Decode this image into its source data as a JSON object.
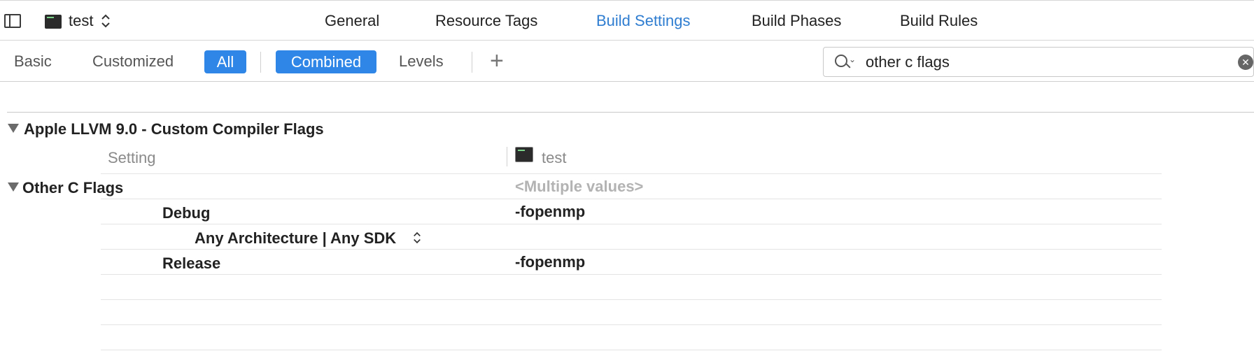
{
  "toolbar": {
    "target_name": "test",
    "tabs": [
      "General",
      "Resource Tags",
      "Build Settings",
      "Build Phases",
      "Build Rules"
    ],
    "active_tab": "Build Settings"
  },
  "filter": {
    "scope": [
      "Basic",
      "Customized",
      "All"
    ],
    "scope_selected": "All",
    "view": [
      "Combined",
      "Levels"
    ],
    "view_selected": "Combined",
    "add_label": "+",
    "search_value": "other c flags",
    "clear_label": "✕"
  },
  "section": {
    "title": "Apple LLVM 9.0 - Custom Compiler Flags",
    "column_setting": "Setting",
    "column_target": "test"
  },
  "setting": {
    "name": "Other C Flags",
    "value": "<Multiple values>",
    "debug_label": "Debug",
    "debug_value": "-fopenmp",
    "arch_label": "Any Architecture | Any SDK",
    "release_label": "Release",
    "release_value": "-fopenmp"
  },
  "colors": {
    "accent": "#2f86e6",
    "active_tab": "#2f7dd1"
  }
}
